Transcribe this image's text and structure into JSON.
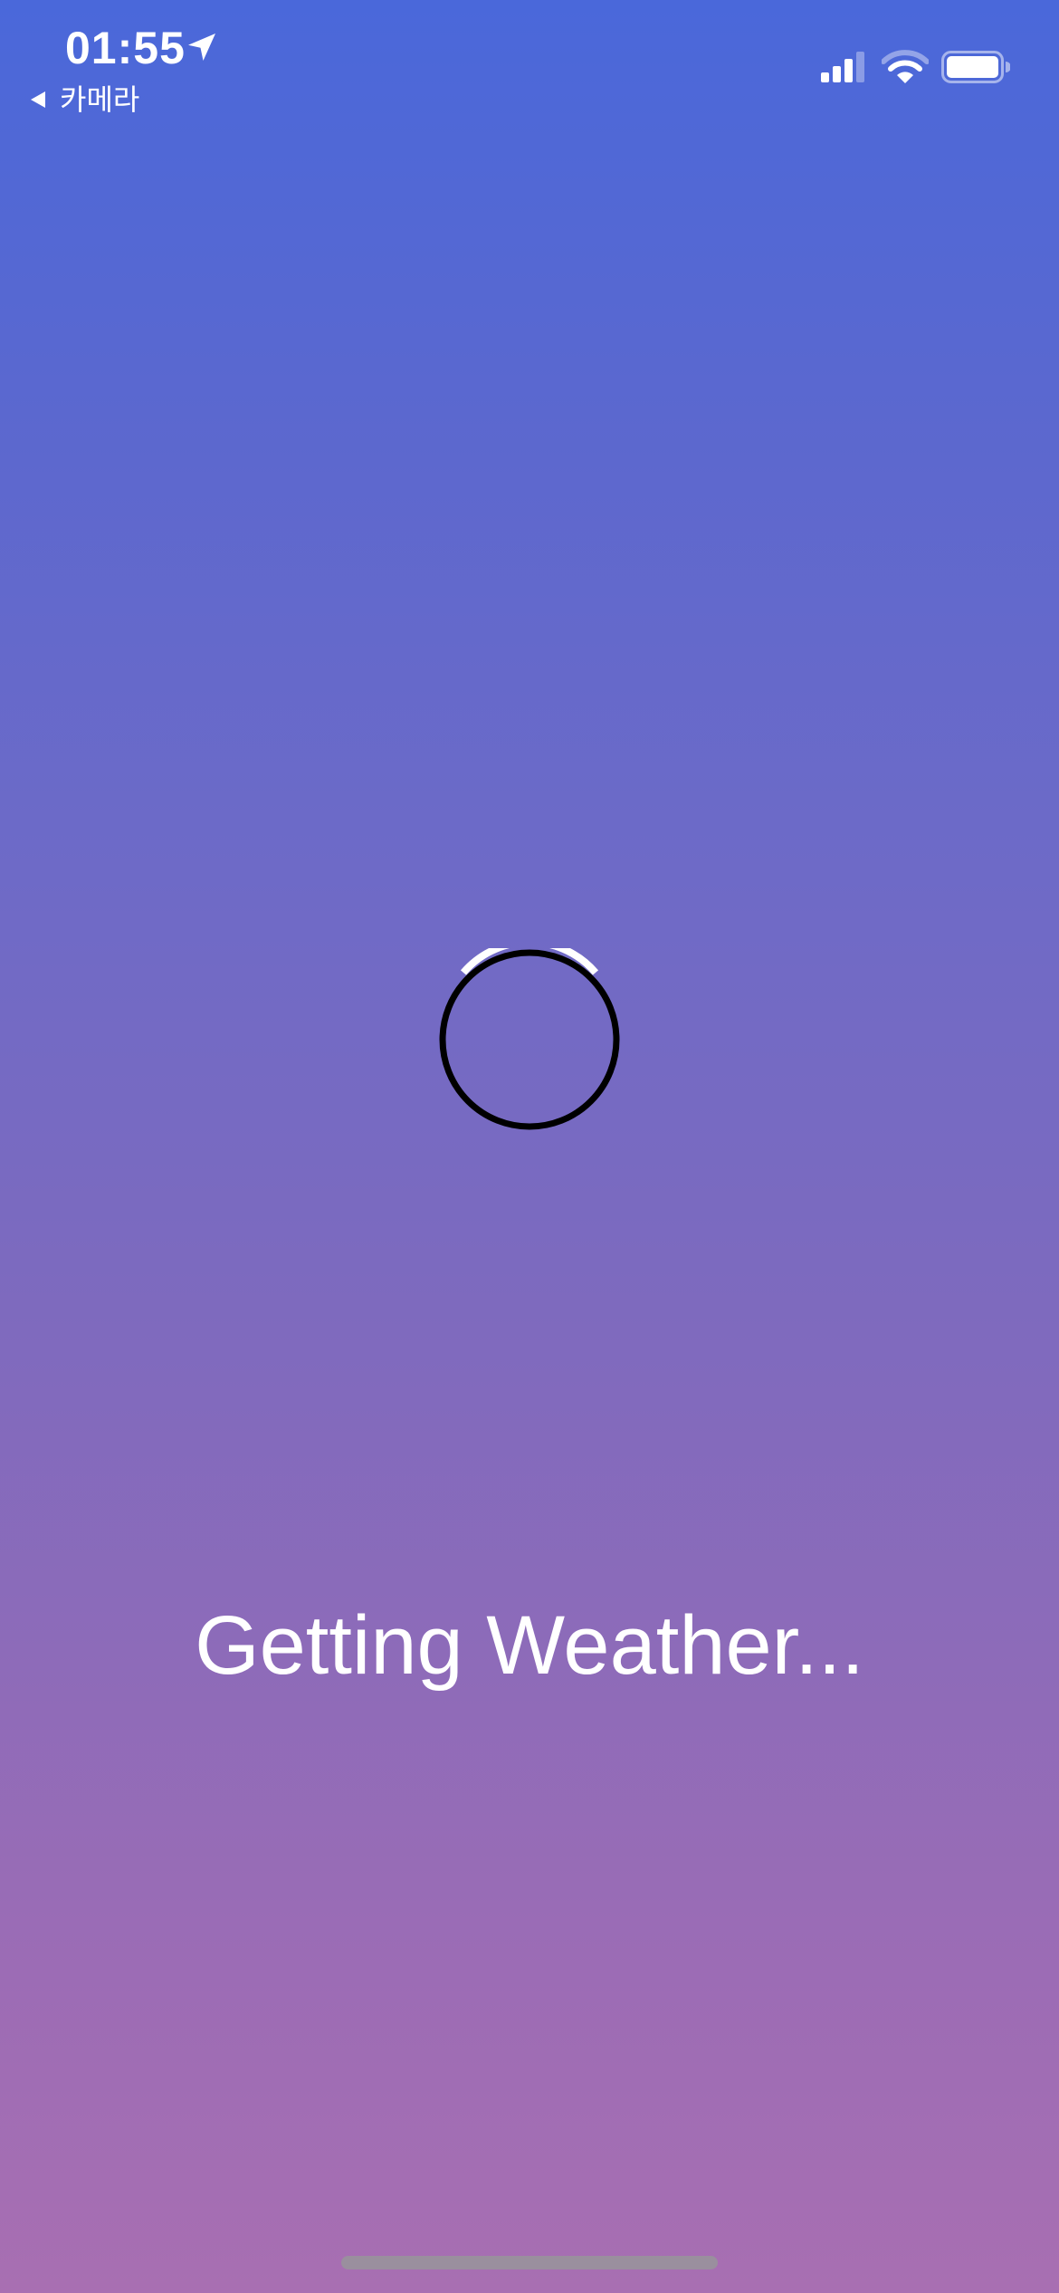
{
  "status_bar": {
    "time": "01:55",
    "back_label": "카메라",
    "icons": [
      "location-arrow-icon",
      "back-arrow-icon",
      "cellular-signal-icon",
      "wifi-icon",
      "battery-icon"
    ]
  },
  "loading": {
    "message": "Getting Weather..."
  },
  "colors": {
    "gradient_top": "#4a68da",
    "gradient_bottom": "#a86fb2",
    "spinner_track": "#000000",
    "spinner_arc": "#ffffff",
    "text": "#ffffff",
    "home_indicator": "#9a8f9e"
  }
}
